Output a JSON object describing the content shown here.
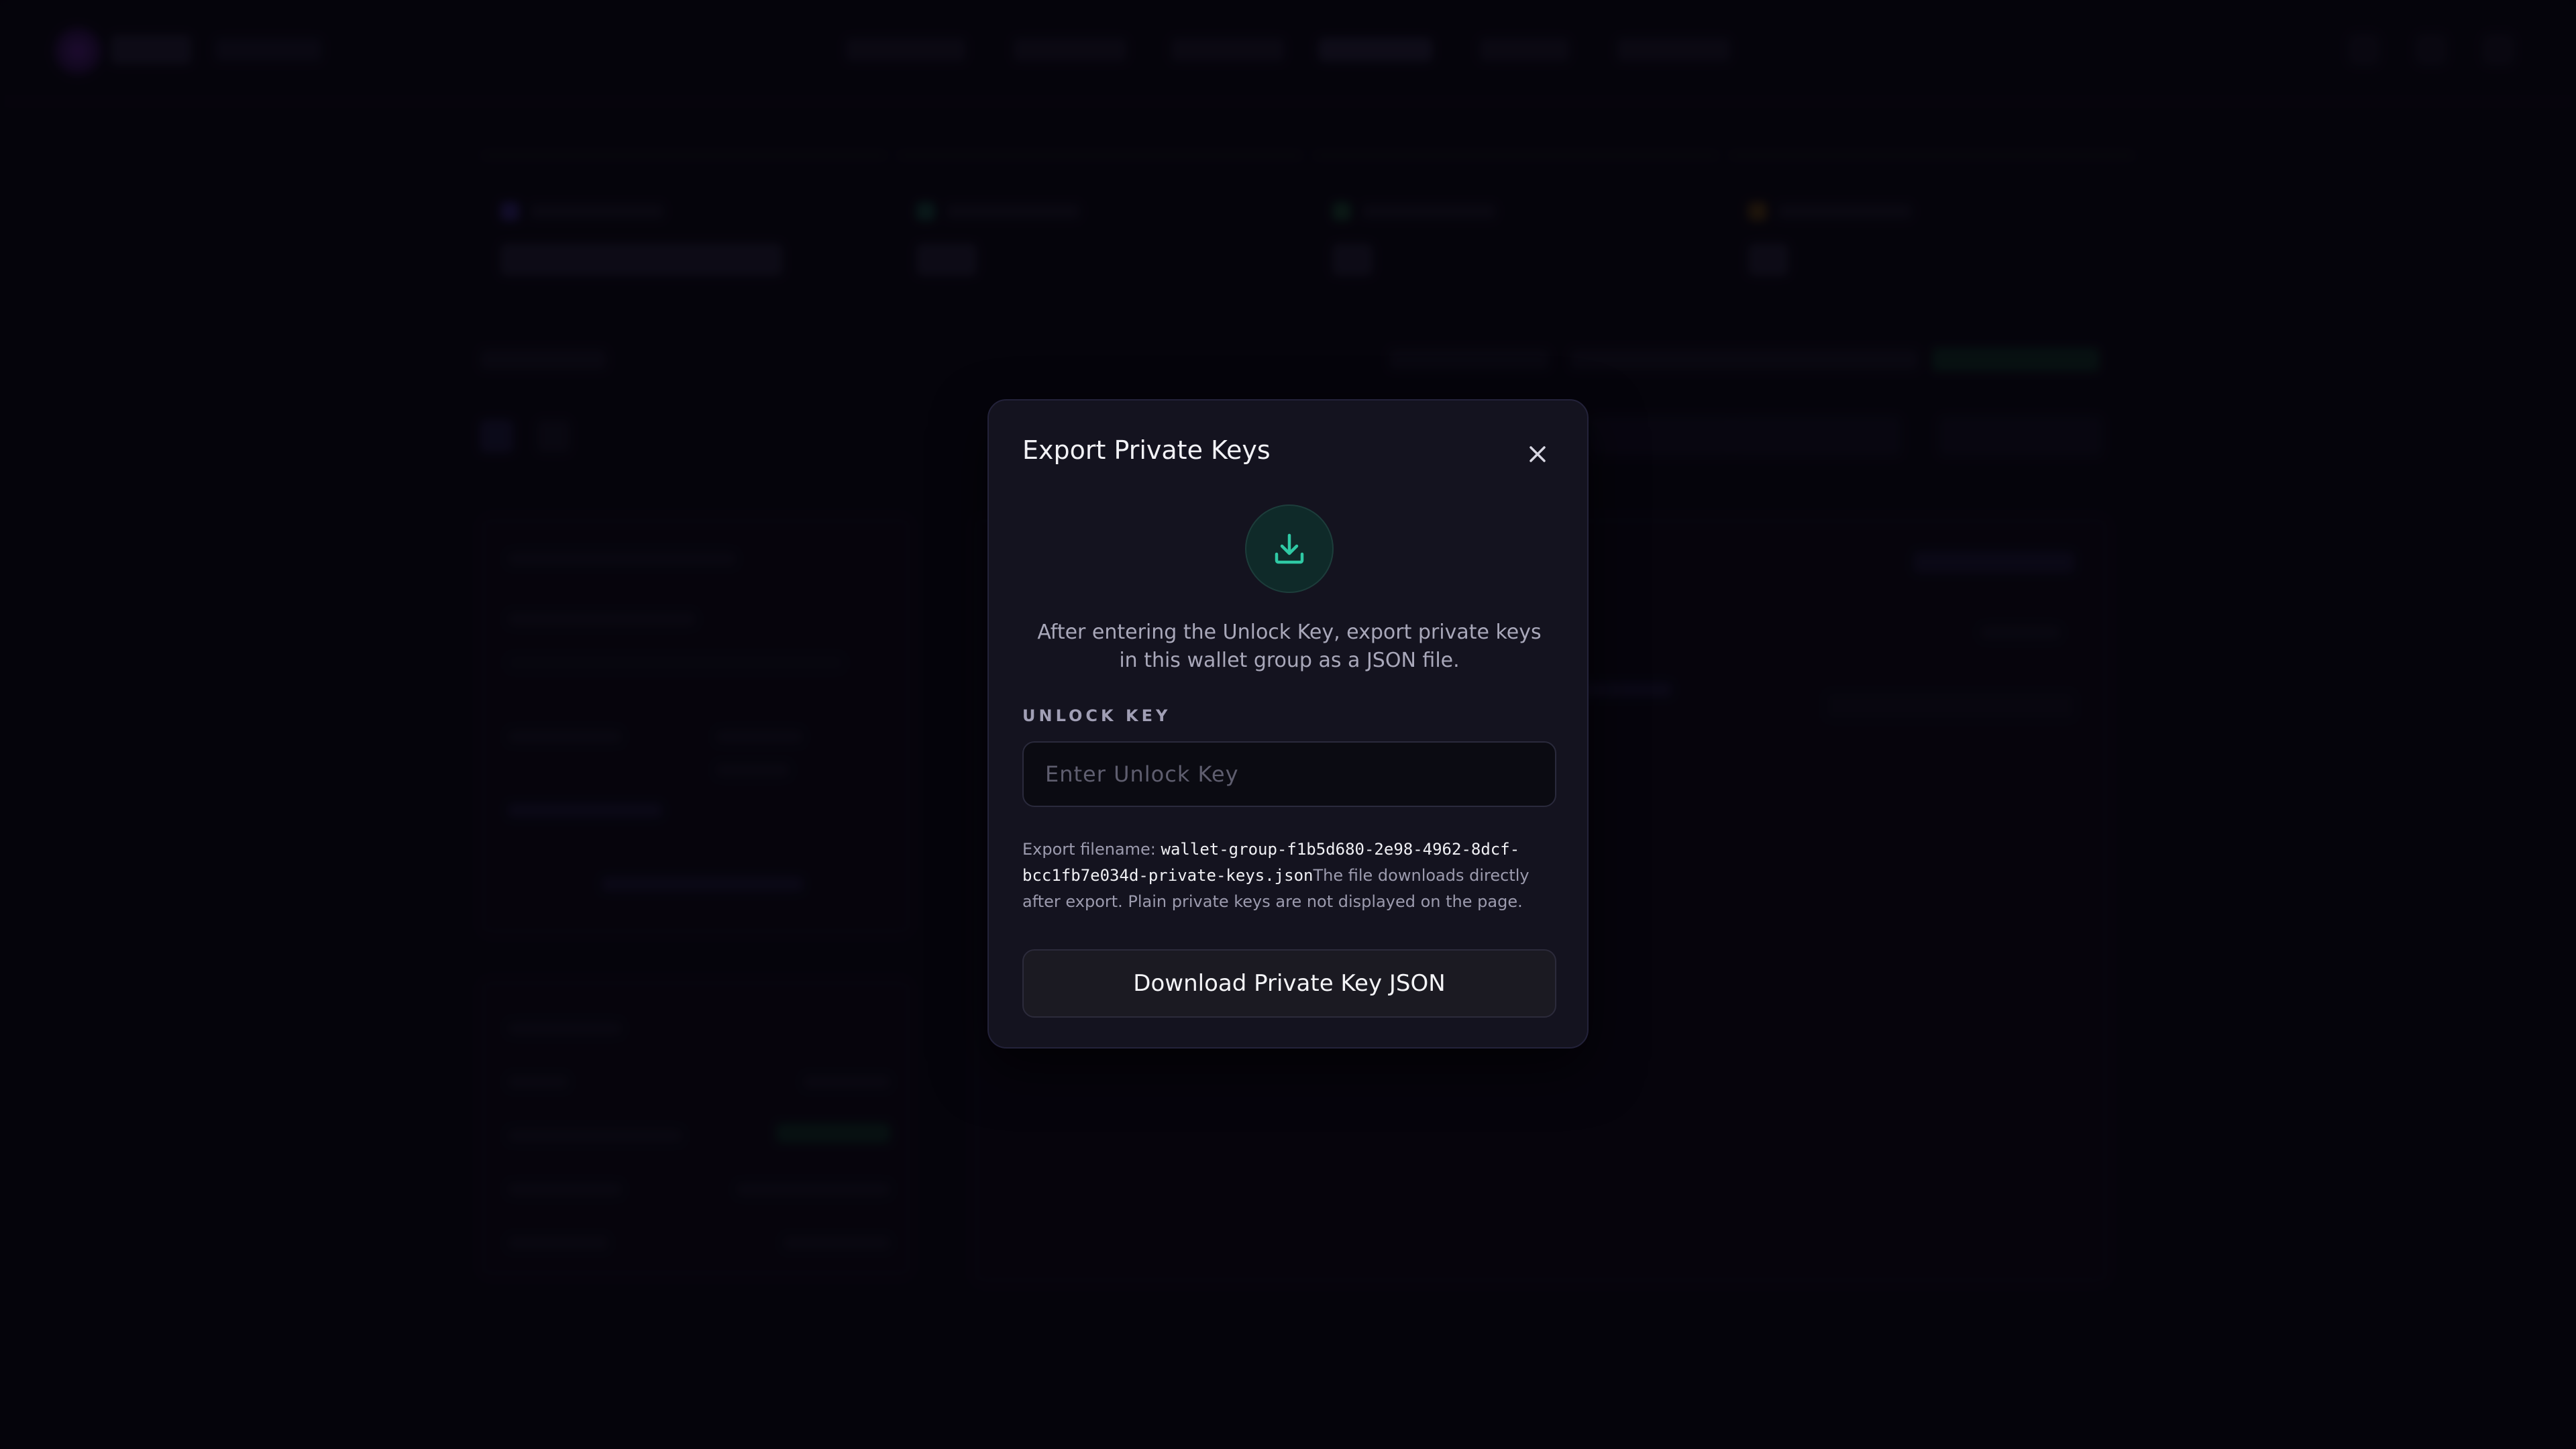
{
  "modal": {
    "title": "Export Private Keys",
    "close_icon": "close-icon",
    "hero_icon": "download-icon",
    "description": "After entering the Unlock Key, export private keys in this wallet group as a JSON file.",
    "field_label": "UNLOCK KEY",
    "input": {
      "value": "",
      "placeholder": "Enter Unlock Key"
    },
    "note_prefix": "Export filename: ",
    "filename": "wallet-group-f1b5d680-2e98-4962-8dcf-bcc1fb7e034d-private-keys.json",
    "note_suffix": "The file downloads directly after export. Plain private keys are not displayed on the page.",
    "download_label": "Download Private Key JSON"
  },
  "colors": {
    "accent": "#2fc9a4",
    "modal_bg": "#14131f",
    "page_bg": "#07060f"
  }
}
